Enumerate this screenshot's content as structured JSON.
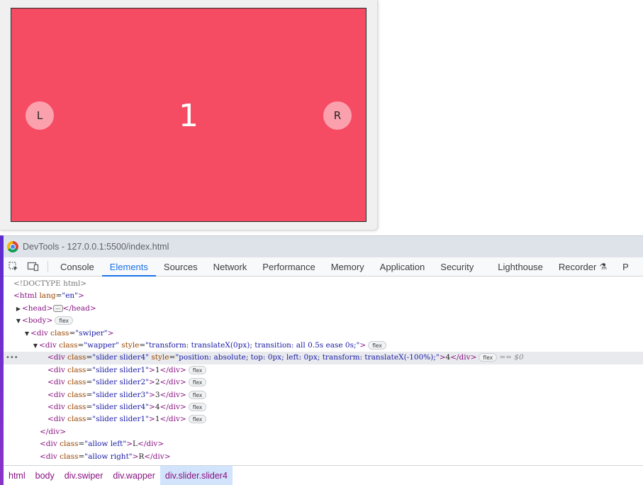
{
  "page": {
    "slide_number": "1",
    "left_button": "L",
    "right_button": "R",
    "swiper_color": "#f64c63",
    "button_color": "#fba1ad"
  },
  "devtools": {
    "title": "DevTools - 127.0.0.1:5500/index.html",
    "icons": [
      "inspect-element-icon",
      "device-toolbar-icon"
    ],
    "tabs": [
      "Console",
      "Elements",
      "Sources",
      "Network",
      "Performance",
      "Memory",
      "Application",
      "Security",
      "Lighthouse",
      "Recorder",
      "P"
    ],
    "active_tab": "Elements",
    "tree": {
      "doctype": "<!DOCTYPE html>",
      "html_open": "<html",
      "lang_attr": "lang",
      "lang_val": "\"en\"",
      "head": "<head>",
      "head_close": "</head>",
      "body": "<body>",
      "div_open": "<div",
      "class_attr": "class",
      "style_attr": "style",
      "swiper_class": "\"swiper\"",
      "wapper_class": "\"wapper\"",
      "wapper_style": "\"transform: translateX(0px); transition: all 0.5s ease 0s;\"",
      "selected_class": "\"slider slider4\"",
      "selected_style": "\"position: absolute; top: 0px; left: 0px; transform: translateX(-100%);\"",
      "selected_text": "4",
      "selected_suffix": "== $0",
      "sliders": [
        {
          "class": "\"slider slider1\"",
          "text": "1"
        },
        {
          "class": "\"slider slider2\"",
          "text": "2"
        },
        {
          "class": "\"slider slider3\"",
          "text": "3"
        },
        {
          "class": "\"slider slider4\"",
          "text": "4"
        },
        {
          "class": "\"slider slider1\"",
          "text": "1"
        }
      ],
      "div_close": "</div>",
      "allow_left_class": "\"allow left\"",
      "allow_left_text": "L",
      "allow_right_class": "\"allow right\"",
      "allow_right_text": "R",
      "flex_badge": "flex",
      "ellipsis": "…"
    },
    "breadcrumbs": [
      "html",
      "body",
      "div.swiper",
      "div.wapper",
      "div.slider.slider4"
    ]
  }
}
